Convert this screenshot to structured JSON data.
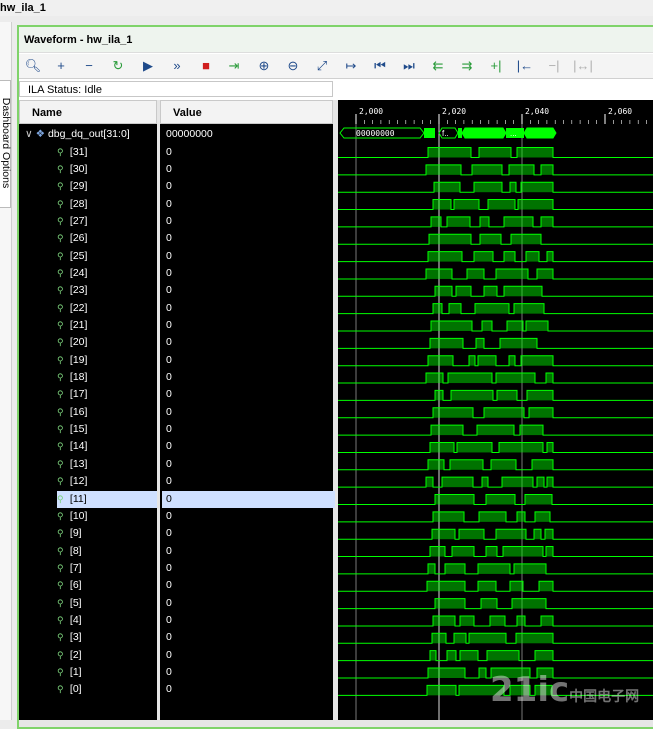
{
  "window_title": "hw_ila_1",
  "side_tab": "Dashboard Options",
  "panel_title": "Waveform - hw_ila_1",
  "ila_status": "ILA Status:  Idle",
  "columns": {
    "name": "Name",
    "value": "Value"
  },
  "bus": {
    "name": "dbg_dq_out[31:0]",
    "value": "00000000"
  },
  "signals": [
    {
      "name": "[31]",
      "value": "0"
    },
    {
      "name": "[30]",
      "value": "0"
    },
    {
      "name": "[29]",
      "value": "0"
    },
    {
      "name": "[28]",
      "value": "0"
    },
    {
      "name": "[27]",
      "value": "0"
    },
    {
      "name": "[26]",
      "value": "0"
    },
    {
      "name": "[25]",
      "value": "0"
    },
    {
      "name": "[24]",
      "value": "0"
    },
    {
      "name": "[23]",
      "value": "0"
    },
    {
      "name": "[22]",
      "value": "0"
    },
    {
      "name": "[21]",
      "value": "0"
    },
    {
      "name": "[20]",
      "value": "0"
    },
    {
      "name": "[19]",
      "value": "0"
    },
    {
      "name": "[18]",
      "value": "0"
    },
    {
      "name": "[17]",
      "value": "0"
    },
    {
      "name": "[16]",
      "value": "0"
    },
    {
      "name": "[15]",
      "value": "0"
    },
    {
      "name": "[14]",
      "value": "0"
    },
    {
      "name": "[13]",
      "value": "0"
    },
    {
      "name": "[12]",
      "value": "0"
    },
    {
      "name": "[11]",
      "value": "0",
      "selected": true
    },
    {
      "name": "[10]",
      "value": "0"
    },
    {
      "name": "[9]",
      "value": "0"
    },
    {
      "name": "[8]",
      "value": "0"
    },
    {
      "name": "[7]",
      "value": "0"
    },
    {
      "name": "[6]",
      "value": "0"
    },
    {
      "name": "[5]",
      "value": "0"
    },
    {
      "name": "[4]",
      "value": "0"
    },
    {
      "name": "[3]",
      "value": "0"
    },
    {
      "name": "[2]",
      "value": "0"
    },
    {
      "name": "[1]",
      "value": "0"
    },
    {
      "name": "[0]",
      "value": "0"
    }
  ],
  "timeline": {
    "ticks": [
      "2,000",
      "2,020",
      "2,040",
      "2,060"
    ]
  },
  "bus_wave_labels": [
    "00000000",
    "f..",
    "..."
  ],
  "colors": {
    "wave": "#00ff00",
    "panel_border": "#7fd36a",
    "selection": "#cfe0ff"
  },
  "toolbar_icons": [
    "search-icon",
    "add-icon",
    "remove-icon",
    "refresh-icon",
    "run-icon",
    "run-all-icon",
    "stop-icon",
    "export-icon",
    "zoom-in-icon",
    "zoom-out-icon",
    "zoom-fit-icon",
    "add-marker-icon",
    "go-first-icon",
    "go-last-icon",
    "prev-transition-icon",
    "next-transition-icon",
    "add-cursor-icon",
    "swap-cursor-icon",
    "remove-cursor-icon",
    "fit-cursor-icon"
  ],
  "watermark": "21ic",
  "watermark_sub": "中国电子网"
}
